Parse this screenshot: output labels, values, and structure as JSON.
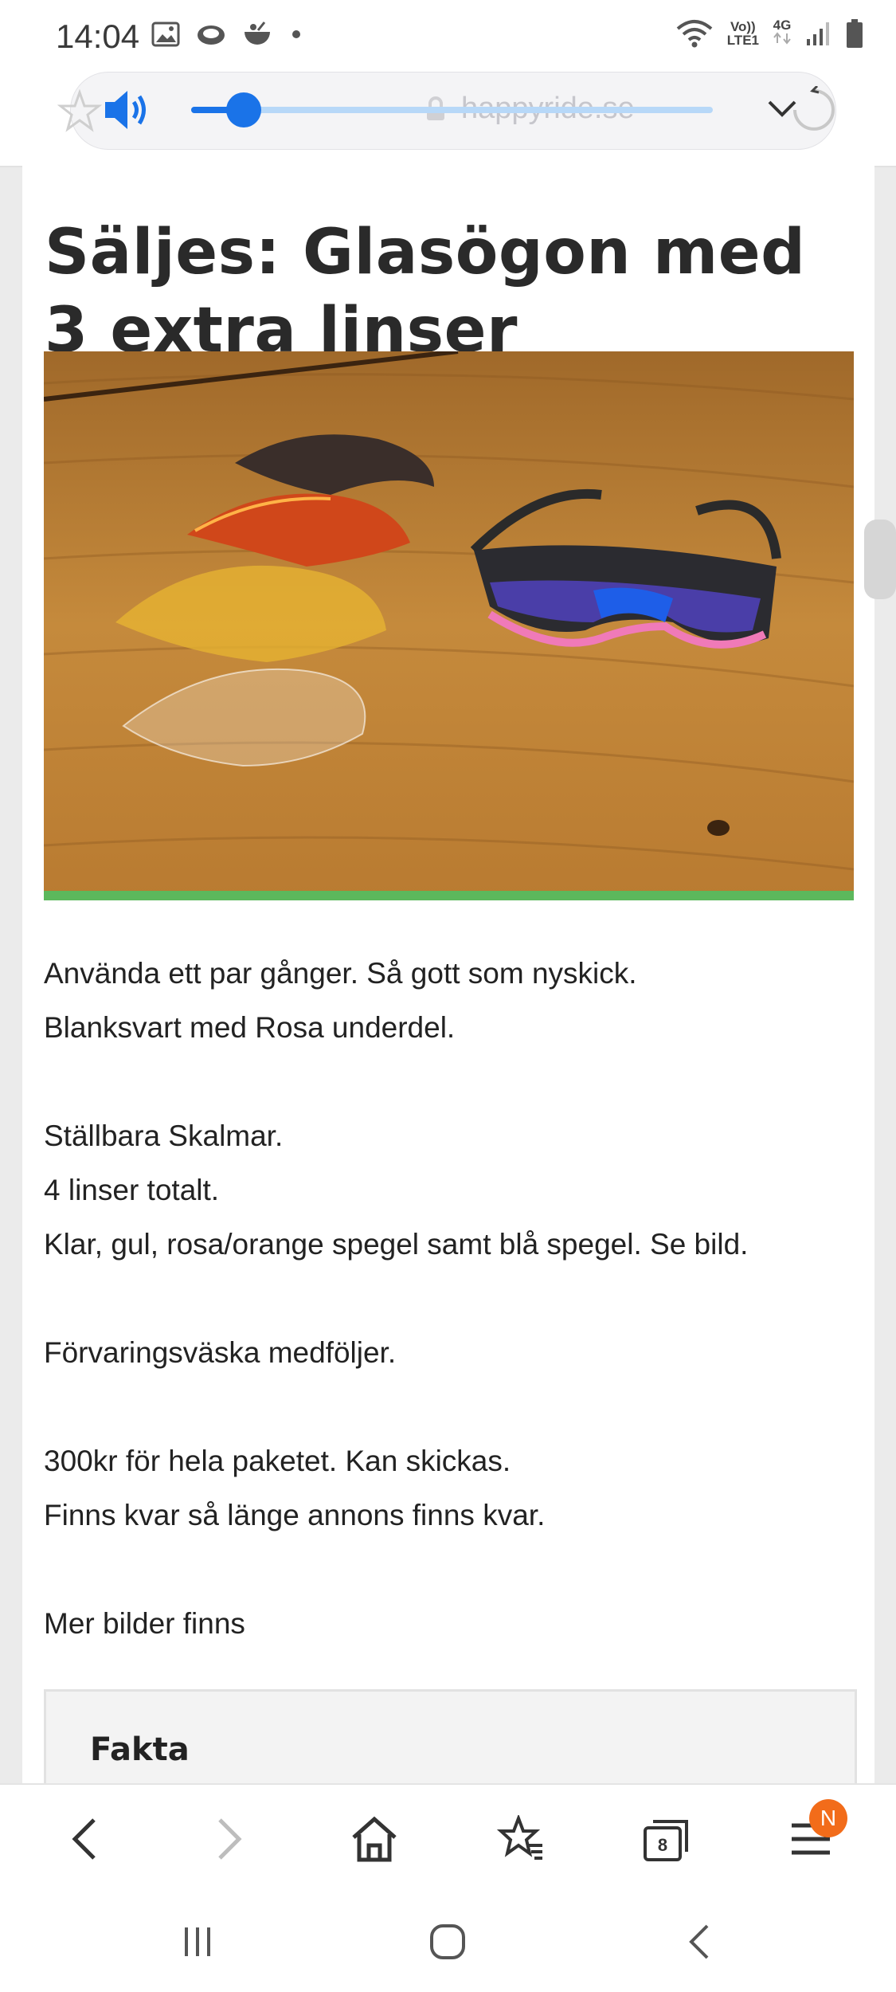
{
  "status_bar": {
    "time": "14:04",
    "left_icons": [
      "image-icon",
      "cloud-icon",
      "bowl-icon",
      "dot-icon"
    ],
    "network_label_top": "Vo))",
    "network_label_bottom": "LTE1",
    "network_type": "4G"
  },
  "browser": {
    "url": "happyride.se",
    "media_volume": 0.1
  },
  "post": {
    "title": "Säljes: Glasögon med 3 extra linser",
    "body_lines": [
      "Använda ett par gånger. Så gott som nyskick.",
      "Blanksvart med Rosa underdel.",
      "",
      "Ställbara Skalmar.",
      "4 linser totalt.",
      "Klar, gul, rosa/orange spegel samt blå spegel. Se bild.",
      "",
      "Förvaringsväska medföljer.",
      "",
      "300kr för hela paketet. Kan skickas.",
      "Finns kvar så länge annons finns kvar.",
      "",
      "Mer bilder finns"
    ],
    "fakta_title": "Fakta"
  },
  "toolbar": {
    "tab_count": "8",
    "menu_badge": "N"
  },
  "colors": {
    "accent_blue": "#1a73e8",
    "photo_bar_green": "#5cb85c",
    "badge_orange": "#f26c1a"
  }
}
